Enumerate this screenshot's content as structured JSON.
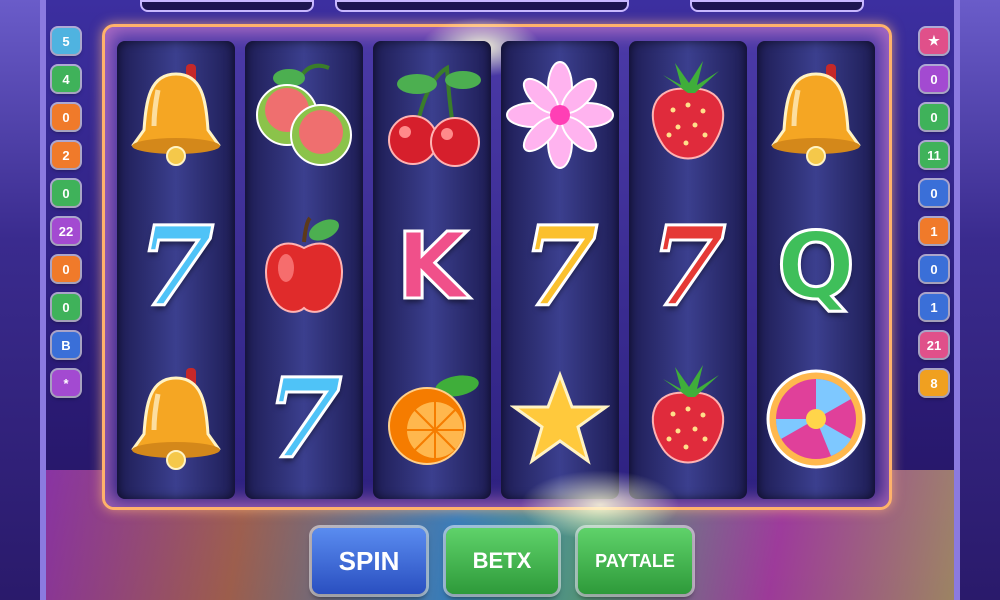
{
  "left_paylines": [
    {
      "label": "5",
      "color": "#4fb3e0"
    },
    {
      "label": "4",
      "color": "#3fb25a"
    },
    {
      "label": "0",
      "color": "#f07a2a"
    },
    {
      "label": "2",
      "color": "#f07a2a"
    },
    {
      "label": "0",
      "color": "#3fb25a"
    },
    {
      "label": "22",
      "color": "#a34ad1"
    },
    {
      "label": "0",
      "color": "#f07a2a"
    },
    {
      "label": "0",
      "color": "#3fb25a"
    },
    {
      "label": "B",
      "color": "#3a6fd8"
    },
    {
      "label": "*",
      "color": "#a34ad1"
    }
  ],
  "right_paylines": [
    {
      "label": "★",
      "color": "#e0508a"
    },
    {
      "label": "0",
      "color": "#a34ad1"
    },
    {
      "label": "0",
      "color": "#3fb25a"
    },
    {
      "label": "11",
      "color": "#3fb25a"
    },
    {
      "label": "0",
      "color": "#3a6fd8"
    },
    {
      "label": "1",
      "color": "#f07a2a"
    },
    {
      "label": "0",
      "color": "#3a6fd8"
    },
    {
      "label": "1",
      "color": "#3a6fd8"
    },
    {
      "label": "21",
      "color": "#e0508a"
    },
    {
      "label": "8",
      "color": "#f0a020"
    }
  ],
  "reels": [
    [
      "bell-icon",
      "seven-icon",
      "bell-icon"
    ],
    [
      "lime-icon",
      "apple-icon",
      "seven-icon"
    ],
    [
      "cherry-icon",
      "k-letter-icon",
      "orange-icon"
    ],
    [
      "flower-icon",
      "seven-icon",
      "star-icon"
    ],
    [
      "strawberry-icon",
      "seven-icon",
      "strawberry-icon"
    ],
    [
      "bell-icon",
      "q-letter-icon",
      "wheel-icon"
    ]
  ],
  "symbols": {
    "seven_text": "7",
    "k_text": "K",
    "q_text": "Q"
  },
  "controls": {
    "spin_label": "SPIN",
    "bet_label": "BETX",
    "paytable_label": "PAYTALE"
  }
}
